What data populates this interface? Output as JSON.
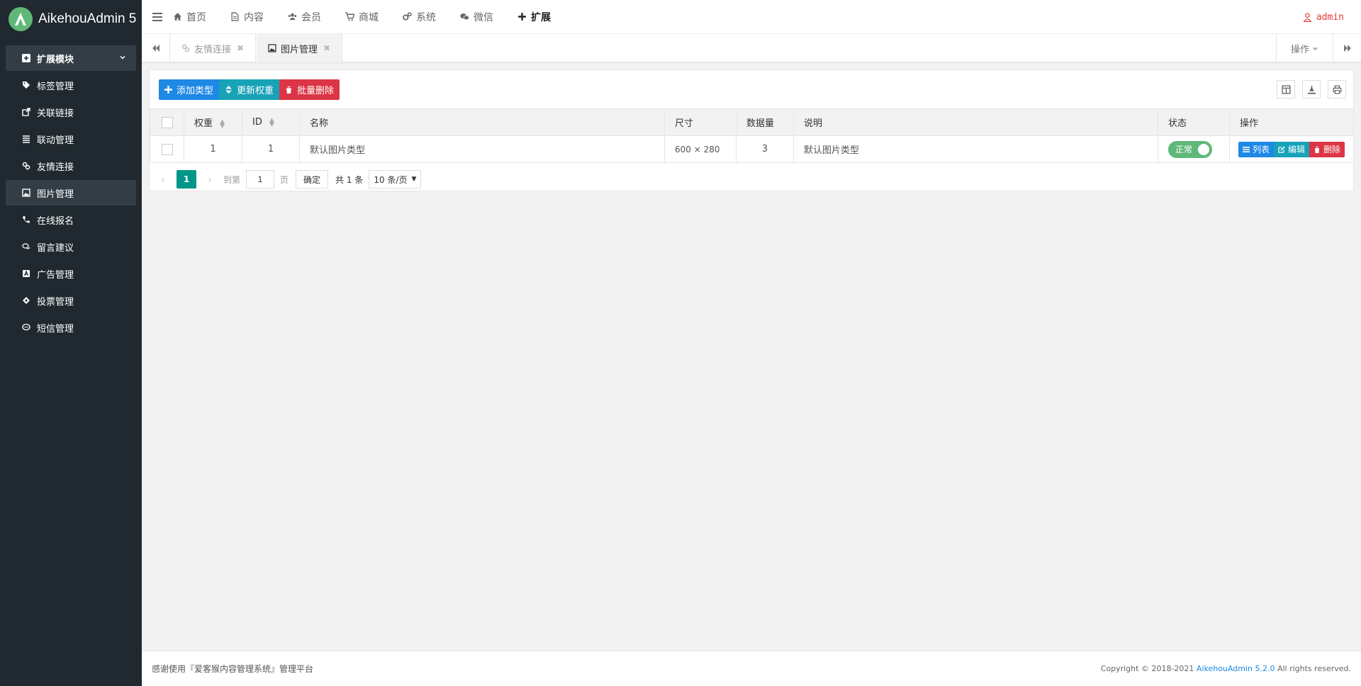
{
  "app": {
    "title": "AikehouAdmin 5"
  },
  "sidebar": {
    "group": {
      "label": "扩展模块"
    },
    "items": [
      {
        "label": "标签管理",
        "icon": "tag-icon"
      },
      {
        "label": "关联链接",
        "icon": "external-link-icon"
      },
      {
        "label": "联动管理",
        "icon": "list-icon"
      },
      {
        "label": "友情连接",
        "icon": "link-icon"
      },
      {
        "label": "图片管理",
        "icon": "image-icon",
        "active": true
      },
      {
        "label": "在线报名",
        "icon": "phone-icon"
      },
      {
        "label": "留言建议",
        "icon": "comments-icon"
      },
      {
        "label": "广告管理",
        "icon": "ad-icon"
      },
      {
        "label": "投票管理",
        "icon": "ticket-icon"
      },
      {
        "label": "短信管理",
        "icon": "sms-icon"
      }
    ]
  },
  "topnav": {
    "items": [
      {
        "label": "首页",
        "icon": "home-icon"
      },
      {
        "label": "内容",
        "icon": "file-icon"
      },
      {
        "label": "会员",
        "icon": "users-icon"
      },
      {
        "label": "商城",
        "icon": "cart-icon"
      },
      {
        "label": "系统",
        "icon": "cogs-icon"
      },
      {
        "label": "微信",
        "icon": "wechat-icon"
      },
      {
        "label": "扩展",
        "icon": "plus-icon",
        "active": true
      }
    ],
    "user": "admin"
  },
  "tabs": {
    "items": [
      {
        "label": "友情连接",
        "close": "✖"
      },
      {
        "label": "图片管理",
        "close": "✖"
      }
    ],
    "operations": "操作"
  },
  "toolbar": {
    "add": "添加类型",
    "update_weight": "更新权重",
    "batch_delete": "批量删除"
  },
  "table": {
    "headers": {
      "weight": "权重",
      "id": "ID",
      "name": "名称",
      "size": "尺寸",
      "count": "数据量",
      "desc": "说明",
      "status": "状态",
      "ops": "操作"
    },
    "rows": [
      {
        "weight": "1",
        "id": "1",
        "name": "默认图片类型",
        "size": "600 × 280",
        "count": "3",
        "desc": "默认图片类型",
        "status": "正常",
        "op_list": "列表",
        "op_edit": "编辑",
        "op_delete": "删除"
      }
    ]
  },
  "pager": {
    "current": "1",
    "goto": "到第",
    "page_input": "1",
    "page_unit": "页",
    "confirm": "确定",
    "total": "共 1 条",
    "per_page": "10 条/页"
  },
  "footer": {
    "left": "感谢使用『爱客猴内容管理系统』管理平台",
    "copyright": "Copyright © 2018-2021",
    "brand": "AikehouAdmin 5.2.0",
    "rights": "All rights reserved."
  },
  "colors": {
    "sidebar_bg": "#20292f",
    "primary": "#1e88e5",
    "teal": "#17a2b8",
    "danger": "#dc3545",
    "success": "#5fb878",
    "pager_active": "#009688"
  }
}
